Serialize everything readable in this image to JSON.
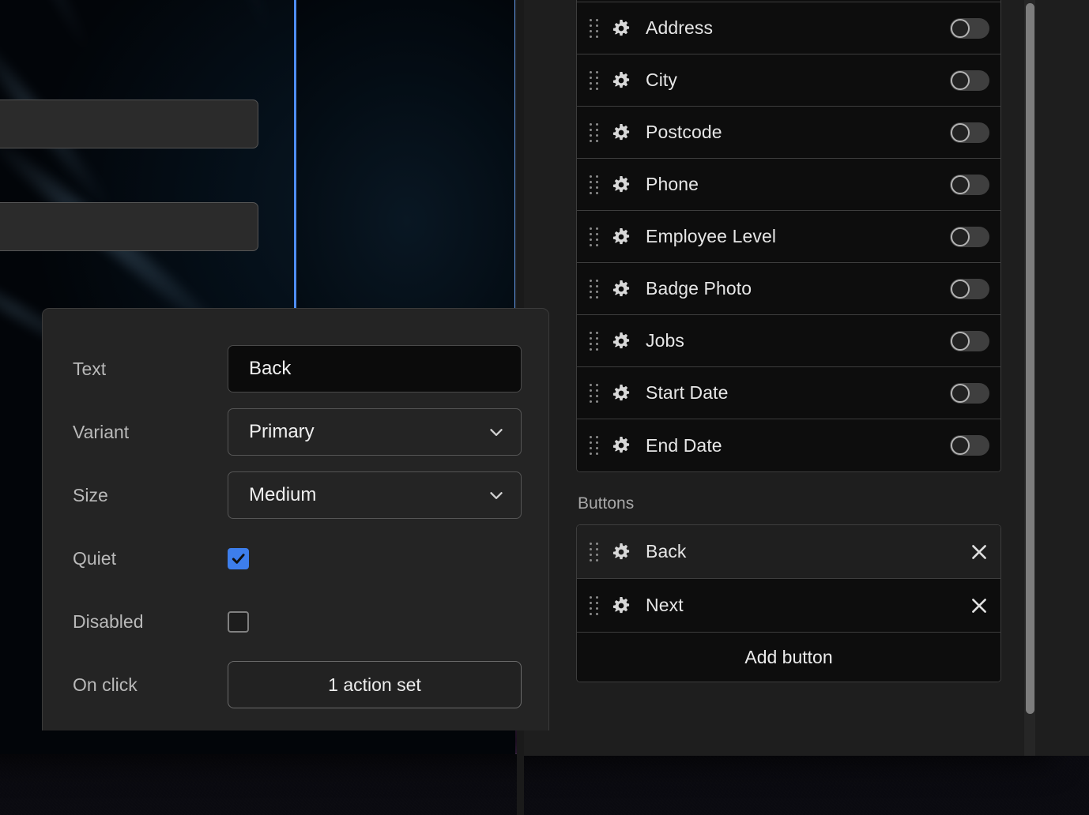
{
  "canvas": {
    "accent_blue": "#4f8ef7",
    "field_placeholders": [
      "",
      ""
    ]
  },
  "properties_popup": {
    "rows": [
      {
        "label": "Text",
        "control": "input",
        "value": "Back"
      },
      {
        "label": "Variant",
        "control": "select",
        "value": "Primary"
      },
      {
        "label": "Size",
        "control": "select",
        "value": "Medium"
      },
      {
        "label": "Quiet",
        "control": "checkbox",
        "checked": true
      },
      {
        "label": "Disabled",
        "control": "checkbox",
        "checked": false
      },
      {
        "label": "On click",
        "control": "button",
        "value": "1 action set"
      }
    ],
    "text_value": "Back",
    "variant_value": "Primary",
    "size_value": "Medium",
    "on_click_value": "1 action set",
    "labels": {
      "text": "Text",
      "variant": "Variant",
      "size": "Size",
      "quiet": "Quiet",
      "disabled": "Disabled",
      "on_click": "On click"
    },
    "accent_checkbox": "#3d7eec"
  },
  "panel": {
    "fields_section": {
      "rows": [
        {
          "label": "Address",
          "toggle": "off"
        },
        {
          "label": "City",
          "toggle": "off"
        },
        {
          "label": "Postcode",
          "toggle": "off"
        },
        {
          "label": "Phone",
          "toggle": "off"
        },
        {
          "label": "Employee Level",
          "toggle": "off"
        },
        {
          "label": "Badge Photo",
          "toggle": "off"
        },
        {
          "label": "Jobs",
          "toggle": "off"
        },
        {
          "label": "Start Date",
          "toggle": "off"
        },
        {
          "label": "End Date",
          "toggle": "off"
        }
      ]
    },
    "buttons_section": {
      "heading": "Buttons",
      "rows": [
        {
          "label": "Back",
          "selected": true
        },
        {
          "label": "Next",
          "selected": false
        }
      ],
      "add_label": "Add button"
    },
    "icons": {
      "drag": "drag-handle-icon",
      "settings": "gear-icon",
      "remove": "close-icon",
      "dropdown": "chevron-down-icon",
      "toggle": "toggle-switch-icon"
    }
  }
}
